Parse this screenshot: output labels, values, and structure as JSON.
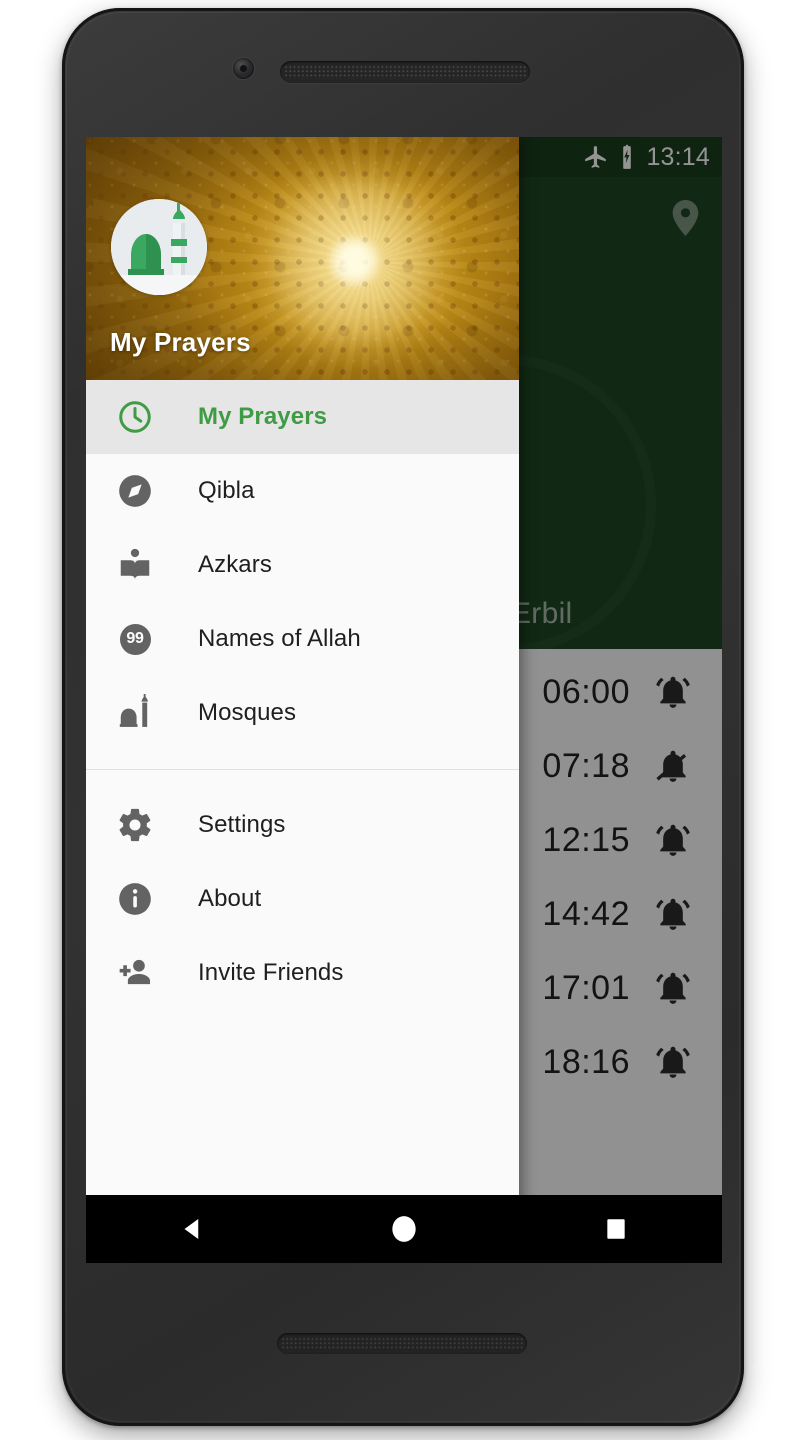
{
  "status_bar": {
    "airplane_icon": "airplane-mode-icon",
    "battery_icon": "battery-charging-icon",
    "clock": "13:14"
  },
  "app": {
    "city": "Erbil",
    "location_icon": "location-pin-icon",
    "header_color": "#1e4723",
    "accent_color": "#3f9c45"
  },
  "prayer_times": [
    {
      "time": "06:00",
      "alarm": "on",
      "alarm_icon": "bell-ring-icon"
    },
    {
      "time": "07:18",
      "alarm": "off",
      "alarm_icon": "bell-off-icon"
    },
    {
      "time": "12:15",
      "alarm": "on",
      "alarm_icon": "bell-ring-icon"
    },
    {
      "time": "14:42",
      "alarm": "on",
      "alarm_icon": "bell-ring-icon"
    },
    {
      "time": "17:01",
      "alarm": "on",
      "alarm_icon": "bell-ring-icon"
    },
    {
      "time": "18:16",
      "alarm": "on",
      "alarm_icon": "bell-ring-icon"
    }
  ],
  "drawer": {
    "title": "My Prayers",
    "avatar_icon": "mosque-avatar-icon",
    "primary_items": [
      {
        "label": "My Prayers",
        "icon": "clock-icon",
        "selected": true
      },
      {
        "label": "Qibla",
        "icon": "compass-icon",
        "selected": false
      },
      {
        "label": "Azkars",
        "icon": "open-book-icon",
        "selected": false
      },
      {
        "label": "Names of Allah",
        "icon": "badge-99-icon",
        "selected": false,
        "badge": "99"
      },
      {
        "label": "Mosques",
        "icon": "mosque-icon",
        "selected": false
      }
    ],
    "secondary_items": [
      {
        "label": "Settings",
        "icon": "gear-icon"
      },
      {
        "label": "About",
        "icon": "info-circle-icon"
      },
      {
        "label": "Invite Friends",
        "icon": "person-add-icon"
      }
    ]
  },
  "navbar": {
    "back": "back-triangle-icon",
    "home": "home-circle-icon",
    "recents": "recents-square-icon"
  }
}
